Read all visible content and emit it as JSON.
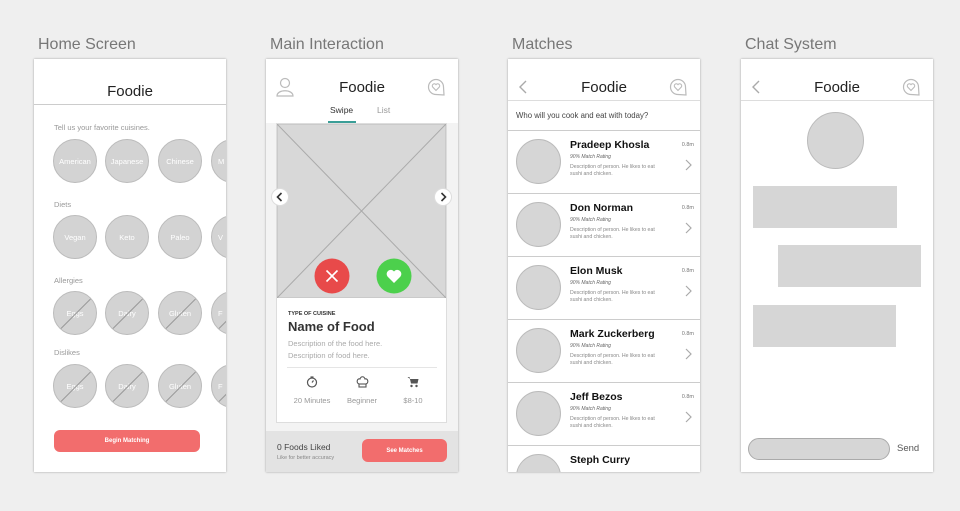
{
  "labels": {
    "home": "Home Screen",
    "main": "Main Interaction",
    "matches": "Matches",
    "chat": "Chat System"
  },
  "app_title": "Foodie",
  "home": {
    "cuisines_label": "Tell us your favorite cuisines.",
    "cuisines": [
      "American",
      "Japanese",
      "Chinese",
      "M"
    ],
    "diets_label": "Diets",
    "diets": [
      "Vegan",
      "Keto",
      "Paleo",
      "V"
    ],
    "allergies_label": "Allergies",
    "allergies": [
      "Eggs",
      "Dairy",
      "Gluten",
      "F"
    ],
    "dislikes_label": "Dislikes",
    "dislikes": [
      "Eggs",
      "Dairy",
      "Gluten",
      "F"
    ],
    "begin_button": "Begin Matching"
  },
  "main": {
    "tabs": [
      "Swipe",
      "List"
    ],
    "active_tab": "Swipe",
    "cuisine_type": "TYPE OF CUISINE",
    "food_name": "Name of Food",
    "description": [
      "Description of the food here.",
      "Description of food here."
    ],
    "stats": [
      {
        "icon": "timer-icon",
        "label": "20 Minutes"
      },
      {
        "icon": "chef-hat-icon",
        "label": "Beginner"
      },
      {
        "icon": "cart-icon",
        "label": "$8-10"
      }
    ],
    "foods_liked": "0 Foods Liked",
    "like_hint": "Like for better accuracy",
    "see_matches": "See Matches"
  },
  "matches": {
    "prompt": "Who will you cook and eat with today?",
    "items": [
      {
        "name": "Pradeep Khosla",
        "rating": "90% Match Rating",
        "desc": "Description of person. He likes to eat sushi and chicken.",
        "distance": "0.8m"
      },
      {
        "name": "Don Norman",
        "rating": "90% Match Rating",
        "desc": "Description of person. He likes to eat sushi and chicken.",
        "distance": "0.8m"
      },
      {
        "name": "Elon Musk",
        "rating": "90% Match Rating",
        "desc": "Description of person. He likes to eat sushi and chicken.",
        "distance": "0.8m"
      },
      {
        "name": "Mark Zuckerberg",
        "rating": "90% Match Rating",
        "desc": "Description of person. He likes to eat sushi and chicken.",
        "distance": "0.8m"
      },
      {
        "name": "Jeff Bezos",
        "rating": "90% Match Rating",
        "desc": "Description of person. He likes to eat sushi and chicken.",
        "distance": "0.8m"
      },
      {
        "name": "Steph Curry",
        "rating": "",
        "desc": "",
        "distance": ""
      }
    ]
  },
  "chat": {
    "send_label": "Send"
  },
  "colors": {
    "accent": "#f26d6d",
    "like": "#4cd04c",
    "dislike": "#e84a4a",
    "tab_underline": "#3a9e97"
  }
}
